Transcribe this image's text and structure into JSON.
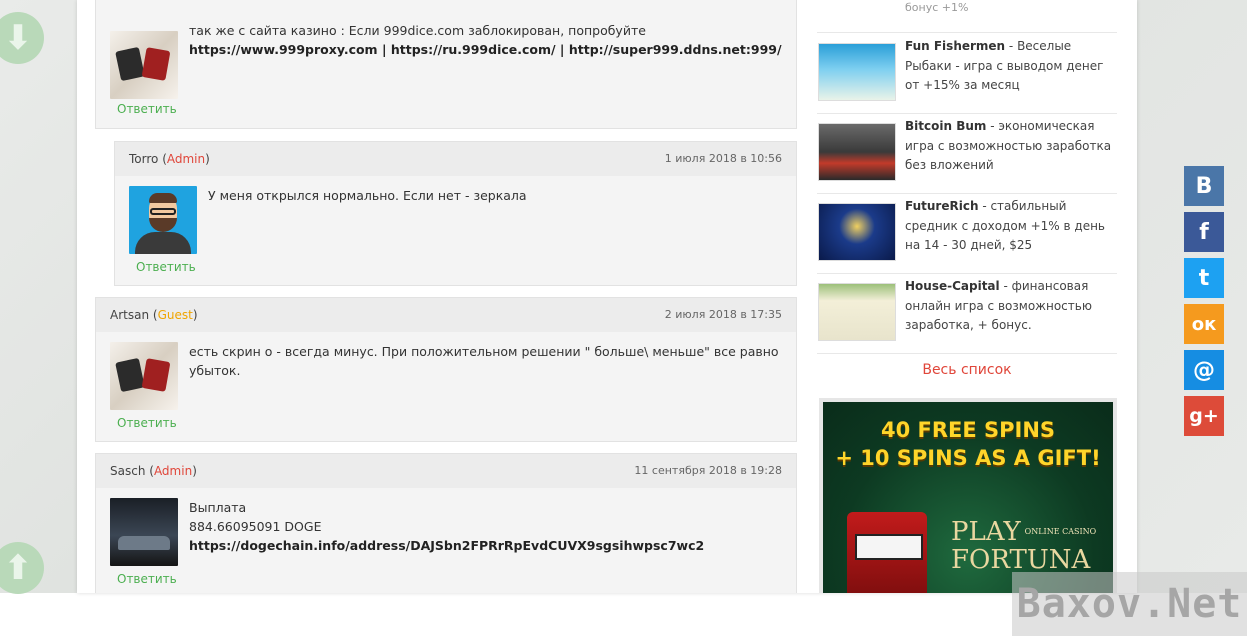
{
  "comments": [
    {
      "author": "",
      "role": "",
      "date": "",
      "lines": [
        "так же с сайта казино : Если 999dice.com заблокирован, попробуйте"
      ],
      "links": "https://www.999proxy.com | https://ru.999dice.com/ | http://super999.ddns.net:999/",
      "reply_label": "Ответить"
    },
    {
      "author": "Torro",
      "role": "Admin",
      "date": "1 июля 2018 в 10:56",
      "text": "У меня открылся нормально. Если нет - зеркала",
      "reply_label": "Ответить"
    },
    {
      "author": "Artsan",
      "role": "Guest",
      "date": "2 июля 2018 в 17:35",
      "line1": "есть скрин о - всегда минус. При положительном решении \" больше\\ меньше\" все равно",
      "line2": "убыток.",
      "reply_label": "Ответить"
    },
    {
      "author": "Sasch",
      "role": "Admin",
      "date": "11 сентября 2018 в 19:28",
      "line1": "Выплата",
      "line2": "884.66095091 DOGE",
      "line3": "https://dogechain.info/address/DAJSbn2FPRrRpEvdCUVX9sgsihwpsc7wc2",
      "reply_label": "Ответить"
    }
  ],
  "sidebar": {
    "partial_text": "бонус +1%",
    "games": [
      {
        "name": "Fun Fishermen",
        "desc": " - Веселые Рыбаки - игра с выводом денег от +15% за месяц"
      },
      {
        "name": "Bitcoin Bum",
        "desc": " - экономическая игра с возможностью заработка без вложений"
      },
      {
        "name": "FutureRich",
        "desc": " - стабильный средник с доходом +1% в день на 14 - 30 дней, $25"
      },
      {
        "name": "House-Capital",
        "desc": " - финансовая онлайн игра с возможностью заработка, + бонус."
      }
    ],
    "all_list_label": "Весь список",
    "banner": {
      "line1": "40 FREE SPINS",
      "line2": "+ 10 SPINS AS A GIFT!",
      "brand_line1": "PLAY",
      "brand_tag": "ONLINE CASINO",
      "brand_line2": "FORTUNA"
    }
  },
  "social": [
    {
      "label": "В",
      "icon": "vk-icon",
      "color": "#4a76a8"
    },
    {
      "label": "f",
      "icon": "facebook-icon",
      "color": "#3b5998"
    },
    {
      "label": "t",
      "icon": "twitter-icon",
      "color": "#1da1f2"
    },
    {
      "label": "ок",
      "icon": "odnoklassniki-icon",
      "color": "#f59a1e"
    },
    {
      "label": "@",
      "icon": "mailru-icon",
      "color": "#168de2"
    },
    {
      "label": "g+",
      "icon": "googleplus-icon",
      "color": "#dd4b39"
    }
  ],
  "watermark": "Baxov.Net"
}
